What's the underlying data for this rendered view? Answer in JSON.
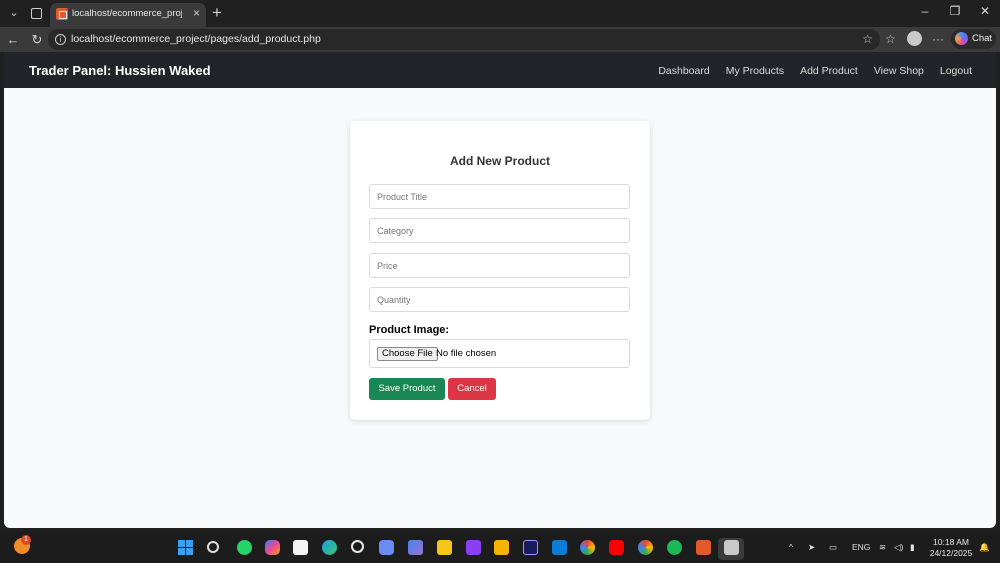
{
  "browser": {
    "tab_title": "localhost/ecommerce_project/pag",
    "url": "localhost/ecommerce_project/pages/add_product.php",
    "chat_label": "Chat"
  },
  "site": {
    "brand": "Trader Panel: Hussien Waked",
    "nav": [
      "Dashboard",
      "My Products",
      "Add Product",
      "View Shop",
      "Logout"
    ]
  },
  "form": {
    "title": "Add New Product",
    "placeholders": {
      "title": "Product Title",
      "category": "Category",
      "price": "Price",
      "quantity": "Quantity"
    },
    "image_label": "Product Image:",
    "choose_file": "Choose File",
    "file_status": "No file chosen",
    "save": "Save Product",
    "cancel": "Cancel"
  },
  "taskbar": {
    "weather_badge": "1",
    "language": "ENG",
    "time": "10:18 AM",
    "date": "24/12/2025"
  },
  "colors": {
    "navbar": "#212529",
    "save": "#198754",
    "cancel": "#dc3545",
    "page_bg": "#f8f9fa"
  }
}
